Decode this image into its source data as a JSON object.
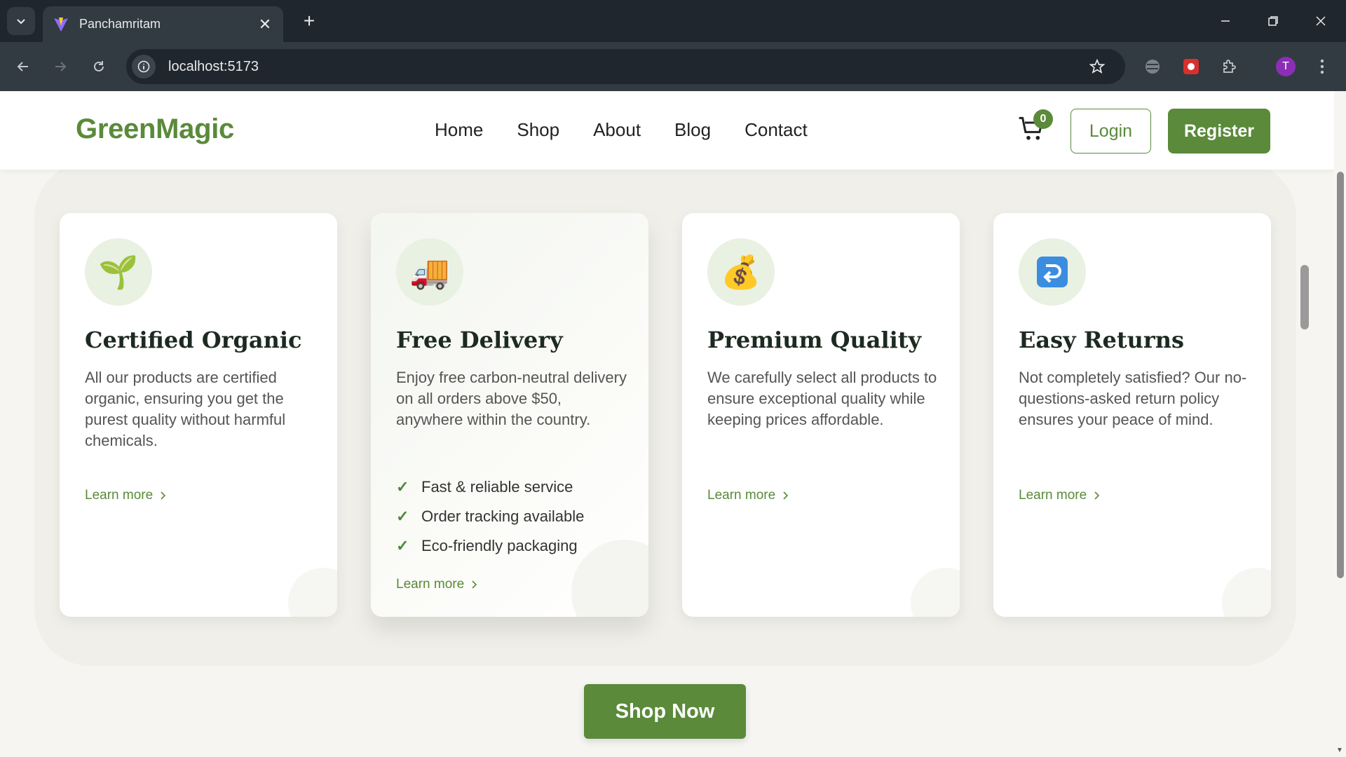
{
  "browser": {
    "tab_title": "Panchamritam",
    "url": "localhost:5173",
    "profile_initial": "T"
  },
  "site": {
    "logo": "GreenMagic",
    "nav": [
      "Home",
      "Shop",
      "About",
      "Blog",
      "Contact"
    ],
    "cart_count": "0",
    "login_label": "Login",
    "register_label": "Register",
    "brand_color": "#5a8a3a"
  },
  "cards": [
    {
      "icon": "seedling-icon",
      "emoji": "🌱",
      "title": "Certified Organic",
      "description": "All our products are certified organic, ensuring you get the purest quality without harmful chemicals.",
      "learn_more": "Learn more"
    },
    {
      "icon": "delivery-truck-icon",
      "emoji": "🚚",
      "title": "Free Delivery",
      "description": "Enjoy free carbon-neutral delivery on all orders above $50, anywhere within the country.",
      "features": [
        "Fast & reliable service",
        "Order tracking available",
        "Eco-friendly packaging"
      ],
      "learn_more": "Learn more"
    },
    {
      "icon": "money-bag-icon",
      "emoji": "💰",
      "title": "Premium Quality",
      "description": "We carefully select all products to ensure exceptional quality while keeping prices affordable.",
      "learn_more": "Learn more"
    },
    {
      "icon": "return-arrow-icon",
      "emoji": "↩",
      "title": "Easy Returns",
      "description": "Not completely satisfied? Our no-questions-asked return policy ensures your peace of mind.",
      "learn_more": "Learn more"
    }
  ],
  "cta": {
    "shop_now": "Shop Now"
  }
}
